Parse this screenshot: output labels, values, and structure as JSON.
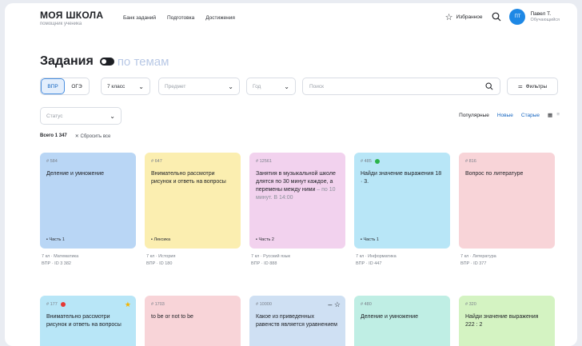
{
  "header": {
    "logo_title": "МОЯ ШКОЛА",
    "logo_sub": "помощник ученика",
    "nav": [
      "Банк заданий",
      "Подготовка",
      "Достижения"
    ],
    "favorites_label": "Избранное",
    "user": {
      "initials": "ПТ",
      "name": "Павел Т.",
      "role": "Обучающийся"
    }
  },
  "page_title": "Задания",
  "page_title_alt": "по темам",
  "filters": {
    "tabs": [
      "ВПР",
      "ОГЭ"
    ],
    "active_tab": "ВПР",
    "class_value": "7 класс",
    "subject_placeholder": "Предмет",
    "year_placeholder": "Год",
    "search_placeholder": "Поиск",
    "filters_label": "Фильтры",
    "status_placeholder": "Статус"
  },
  "sort": {
    "popular": "Популярные",
    "new": "Новые",
    "old": "Старые"
  },
  "total_label": "Всего 1 347",
  "reset_label": "Сбросить все",
  "cards": [
    {
      "id": "# 584",
      "text": "Деление и умножение",
      "tag": "Часть 1",
      "below1": "7 кл · Математика",
      "below2": "ВПР · ID 3 382",
      "color": "#b9d6f5"
    },
    {
      "id": "# 647",
      "text": "Внимательно рассмотри рисунок и ответь на вопросы",
      "tag": "Лексика",
      "below1": "7 кл · История",
      "below2": "ВПР · ID 180",
      "color": "#fbeeb0"
    },
    {
      "id": "# 12561",
      "text": "Занятия в музыкальной школе длятся по 30 минут каждое, а перемены между ними",
      "faded": "– по 10 минут. В 14:00",
      "tag": "Часть 2",
      "below1": "7 кл · Русский язык",
      "below2": "ВПР · ID 888",
      "color": "#f2d2ee"
    },
    {
      "id": "# 485",
      "text": "Найди значение выражения 18 · 3.",
      "tag": "Часть 1",
      "below1": "7 кл · Информатика",
      "below2": "ВПР · ID 447",
      "color": "#b8e6f7",
      "dot": "#2ab44a"
    },
    {
      "id": "# 816",
      "text": "Вопрос по литературе",
      "tag": "",
      "below1": "7 кл · Литература",
      "below2": "ВПР · ID 377",
      "color": "#f8d4d8"
    },
    {
      "id": "# 177",
      "text": "Внимательно рассмотри рисунок и ответь на вопросы",
      "color": "#b8e6f7",
      "dot": "#e53935",
      "corner": "★"
    },
    {
      "id": "# 1703",
      "text": "to be or not to be",
      "color": "#f8d4d8"
    },
    {
      "id": "# 10000",
      "text": "Какое из приведенных равенств является уравнением",
      "color": "#cfe0f3",
      "corner": "– ☆"
    },
    {
      "id": "# 480",
      "text": "Деление и умножение",
      "color": "#bfeee4"
    },
    {
      "id": "# 320",
      "text": "Найди значение выражения 222 : 2",
      "color": "#d4f3c2"
    }
  ]
}
